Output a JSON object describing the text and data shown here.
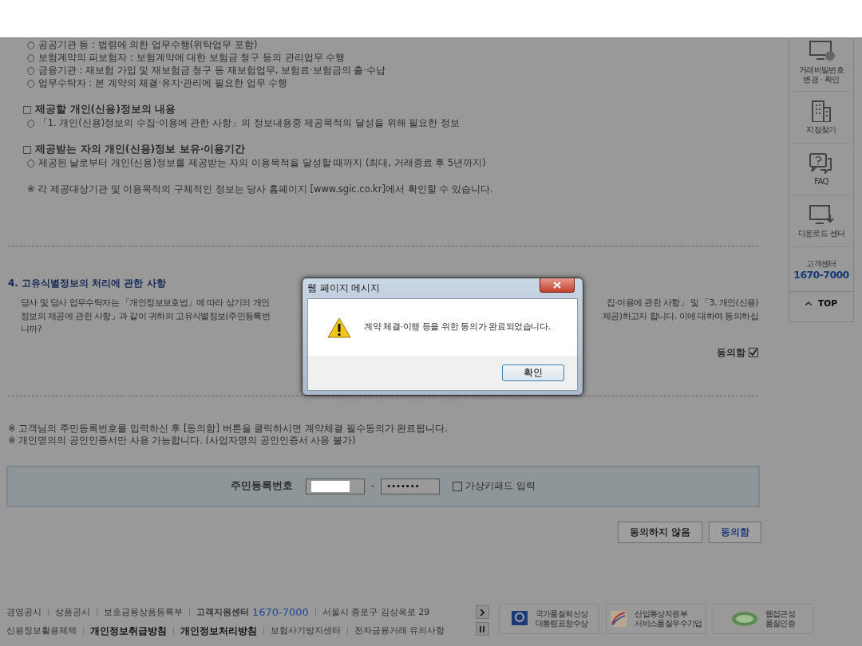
{
  "recipients": [
    "○ 공공기관 등 : 법령에 의한 업무수행(위탁업무 포함)",
    "○ 보험계약의 피보험자 : 보험계약에 대한 보험금 청구 등의 관리업무 수행",
    "○ 금융기관 : 재보험 가입 및 재보험금 청구 등 재보험업무, 보험료·보험금의 출·수납",
    "○ 업무수탁자 : 본 계약의 체결·유지·관리에 필요한 업무 수행"
  ],
  "blocks": [
    {
      "heading": "□ 제공할 개인(신용)정보의 내용",
      "items": [
        "○ 「1. 개인(신용)정보의 수집·이용에 관한 사항」의 정보내용중 제공목적의 달성을 위해 필요한 정보"
      ]
    },
    {
      "heading": "□ 제공받는 자의 개인(신용)정보 보유·이용기간",
      "items": [
        "○ 제공된 날로부터 개인(신용)정보를 제공받는 자의 이용목적을 달성할 때까지 (최대, 거래종료 후 5년까지)"
      ]
    }
  ],
  "note": "※ 각 제공대상기관 및 이용목적의 구체적인 정보는 당사 홈페이지 [www.sgic.co.kr]에서 확인할 수 있습니다.",
  "section4": {
    "title": "4. 고유식별정보의 처리에 관한 사항",
    "lines": [
      {
        "left": "당사 및 당사 업무수탁자는 「개인정보보호법」에 따라 상기의 개인",
        "right": "집·이용에 관한 사항」 및 「3. 개인(신용)"
      },
      {
        "left": "정보의 제공에 관한 사항」과 같이 귀하의 고유식별정보(주민등록번",
        "right": "제공)하고자 합니다. 이에 대하여 동의하십"
      },
      {
        "left": "니까?"
      }
    ],
    "agree": {
      "label": "동의함",
      "checked": true
    }
  },
  "notices": [
    "※ 고객님의 주민등록번호를 입력하신 후 [동의함] 버튼을 클릭하시면 계약체결 필수동의가 완료됩니다.",
    "※ 개인명의의 공인인증서만 사용 가능합니다. (사업자명의 공인인증서 사용 불가)"
  ],
  "ssn": {
    "label": "주민등록번호",
    "separator": "-",
    "back_value": "•••••••",
    "keypad": {
      "label": "가상키패드 입력",
      "checked": false
    }
  },
  "buttons": [
    {
      "label": "동의하지 않음",
      "kind": "plain"
    },
    {
      "label": "동의함",
      "kind": "primary"
    }
  ],
  "footer": {
    "primary_links": [
      {
        "text": "경영공시",
        "kind": "link"
      },
      {
        "text": "상품공시",
        "kind": "link"
      },
      {
        "text": "보호금융상품등록부",
        "kind": "link"
      },
      {
        "text": "고객지원센터",
        "kind": "label",
        "phone": "1670-7000"
      },
      {
        "text": "서울시 종로구 김상옥로 29",
        "kind": "address"
      }
    ],
    "secondary_links": [
      {
        "text": "신용정보활용체제",
        "kind": "link"
      },
      {
        "text": "개인정보취급방침",
        "kind": "bold"
      },
      {
        "text": "개인정보처리방침",
        "kind": "bold"
      },
      {
        "text": "보험사기방지센터",
        "kind": "link"
      },
      {
        "text": "전자금융거래 유의사항",
        "kind": "link"
      }
    ],
    "awards": [
      {
        "kind": "knqa",
        "lines": [
          "국가품질혁신상",
          "대통령표창수상"
        ]
      },
      {
        "kind": "ministry",
        "lines": [
          "산업통상자원부",
          "서비스품질우수기업"
        ]
      },
      {
        "kind": "wa",
        "lines": [
          "웹접근성",
          "품질인증"
        ]
      }
    ]
  },
  "sidebar": {
    "items": [
      {
        "kind": "monitor-lock",
        "lines": [
          "거래비밀번호",
          "변경 · 확인"
        ]
      },
      {
        "kind": "building",
        "lines": [
          "지점찾기"
        ]
      },
      {
        "kind": "faq",
        "lines": [
          "FAQ"
        ]
      },
      {
        "kind": "download",
        "lines": [
          "다운로드 센터"
        ]
      }
    ],
    "center": {
      "label": "고객센터",
      "phone": "1670-7000"
    },
    "top": "TOP"
  },
  "dialog": {
    "title": "웹 페이지 메시지",
    "message": "계약 체결·이행 등을 위한 동의가 완료되었습니다.",
    "button": "확인"
  }
}
